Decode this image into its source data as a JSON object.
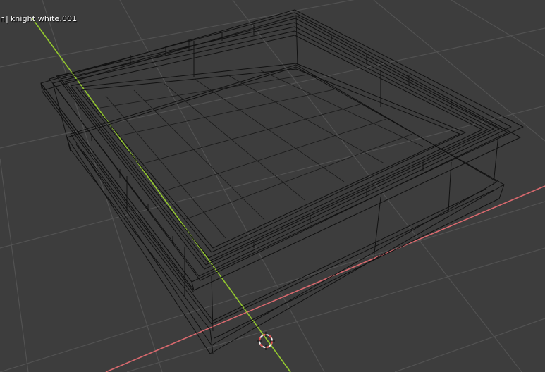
{
  "viewport": {
    "overlay": {
      "prefix": "n",
      "separator": "|",
      "object_name": "knight  white.001"
    },
    "colors": {
      "background": "#3d3d3d",
      "grid": "#525252",
      "x_axis": "#d9696e",
      "y_axis": "#93c82e",
      "wire": "#111111",
      "cursor_red": "#e24a4a",
      "cursor_white": "#f2f2f2"
    },
    "icons": [
      "3d-cursor-icon"
    ]
  }
}
